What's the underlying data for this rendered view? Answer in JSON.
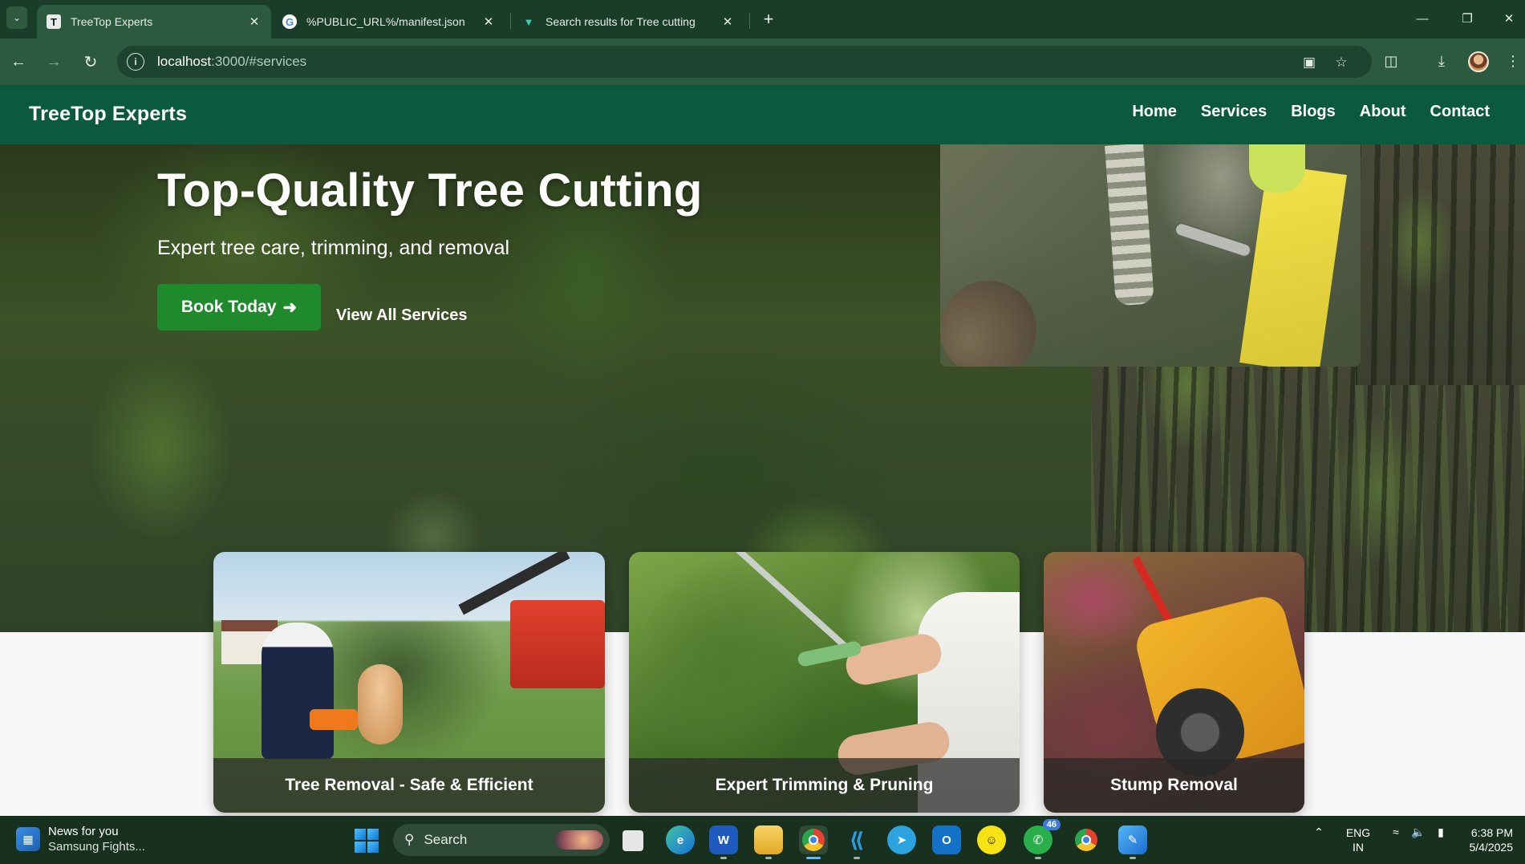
{
  "browser": {
    "tabs": [
      {
        "favicon": "tree-icon",
        "title": "TreeTop Experts",
        "active": true
      },
      {
        "favicon": "google-icon",
        "title": "%PUBLIC_URL%/manifest.json",
        "active": false
      },
      {
        "favicon": "vuetify-icon",
        "title": "Search results for Tree cutting",
        "active": false
      }
    ],
    "url": {
      "host": "localhost",
      "path": ":3000/#services"
    }
  },
  "site": {
    "brand": "TreeTop Experts",
    "nav": [
      "Home",
      "Services",
      "Blogs",
      "About",
      "Contact"
    ]
  },
  "hero": {
    "title": "Top-Quality Tree Cutting",
    "subtitle": "Expert tree care, trimming, and removal",
    "cta_primary": "Book Today",
    "cta_primary_icon": "arrow-right-icon",
    "cta_secondary": "View All Services",
    "accent_color": "#1f8a2b",
    "nav_color": "#0c5a3e"
  },
  "services": [
    {
      "title": "Tree Removal - Safe & Efficient"
    },
    {
      "title": "Expert Trimming & Pruning"
    },
    {
      "title": "Stump Removal"
    }
  ],
  "taskbar": {
    "news_title": "News for you",
    "news_subtitle": "Samsung Fights...",
    "search_placeholder": "Search",
    "whatsapp_badge": "46",
    "language": "ENG",
    "region": "IN",
    "time": "6:38 PM",
    "date": "5/4/2025"
  }
}
